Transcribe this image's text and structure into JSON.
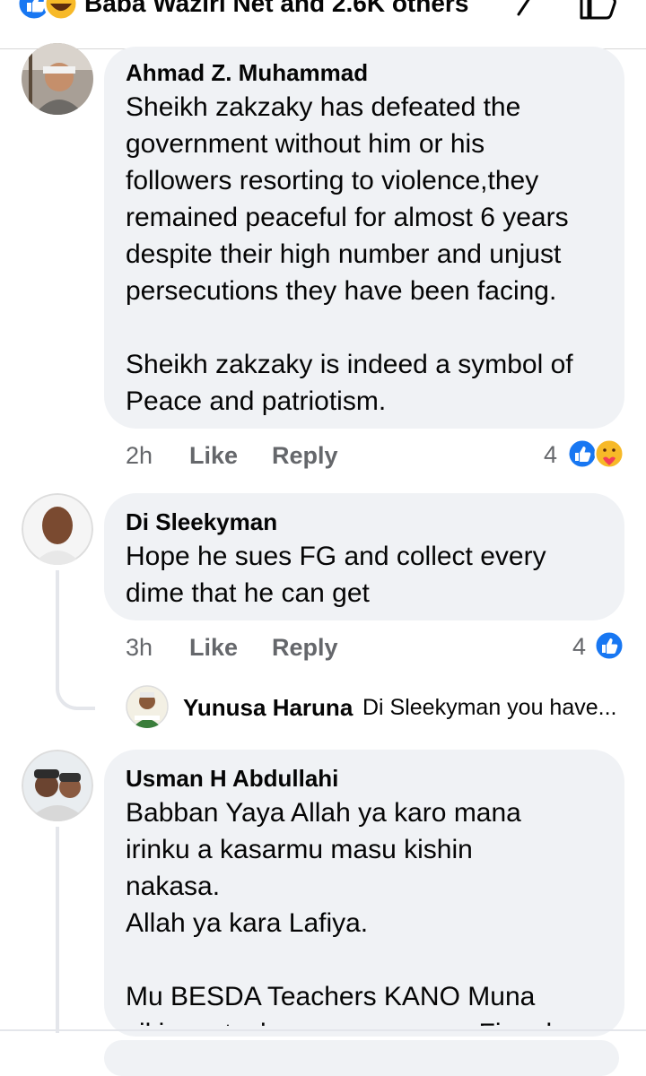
{
  "top_bar": {
    "reactions_text": "Baba Waziri Net and 2.6K others",
    "icons": [
      "like-icon",
      "haha-icon",
      "chevron-right-icon",
      "like-outline-icon"
    ]
  },
  "comments": [
    {
      "author": "Ahmad Z. Muhammad",
      "text": "Sheikh zakzaky has defeated the\ngovernment without him or his\nfollowers resorting to violence,they\nremained peaceful for almost 6 years\ndespite their high number and unjust\npersecutions they have been facing.\n\nSheikh zakzaky is indeed a symbol of\nPeace and patriotism.",
      "time": "2h",
      "like_label": "Like",
      "reply_label": "Reply",
      "reaction_count": "4",
      "reaction_icons": [
        "like-icon",
        "care-icon"
      ]
    },
    {
      "author": "Di Sleekyman",
      "text": "Hope he sues FG and collect every\ndime that he can get",
      "time": "3h",
      "like_label": "Like",
      "reply_label": "Reply",
      "reaction_count": "4",
      "reaction_icons": [
        "like-icon"
      ],
      "reply_preview": {
        "author": "Yunusa Haruna",
        "text": "Di Sleekyman you have..."
      }
    },
    {
      "author": "Usman H Abdullahi",
      "text": "Babban Yaya Allah ya karo mana\nirinku a kasarmu masu kishin\nnakasa.\nAllah ya kara Lafiya.\n\nMu BESDA Teachers KANO Muna\nsikin matsala, sunzuguza mu Five da"
    }
  ],
  "colors": {
    "bubble": "#f0f2f5",
    "secondary_text": "#65676b",
    "like_blue": "#1877f2"
  }
}
